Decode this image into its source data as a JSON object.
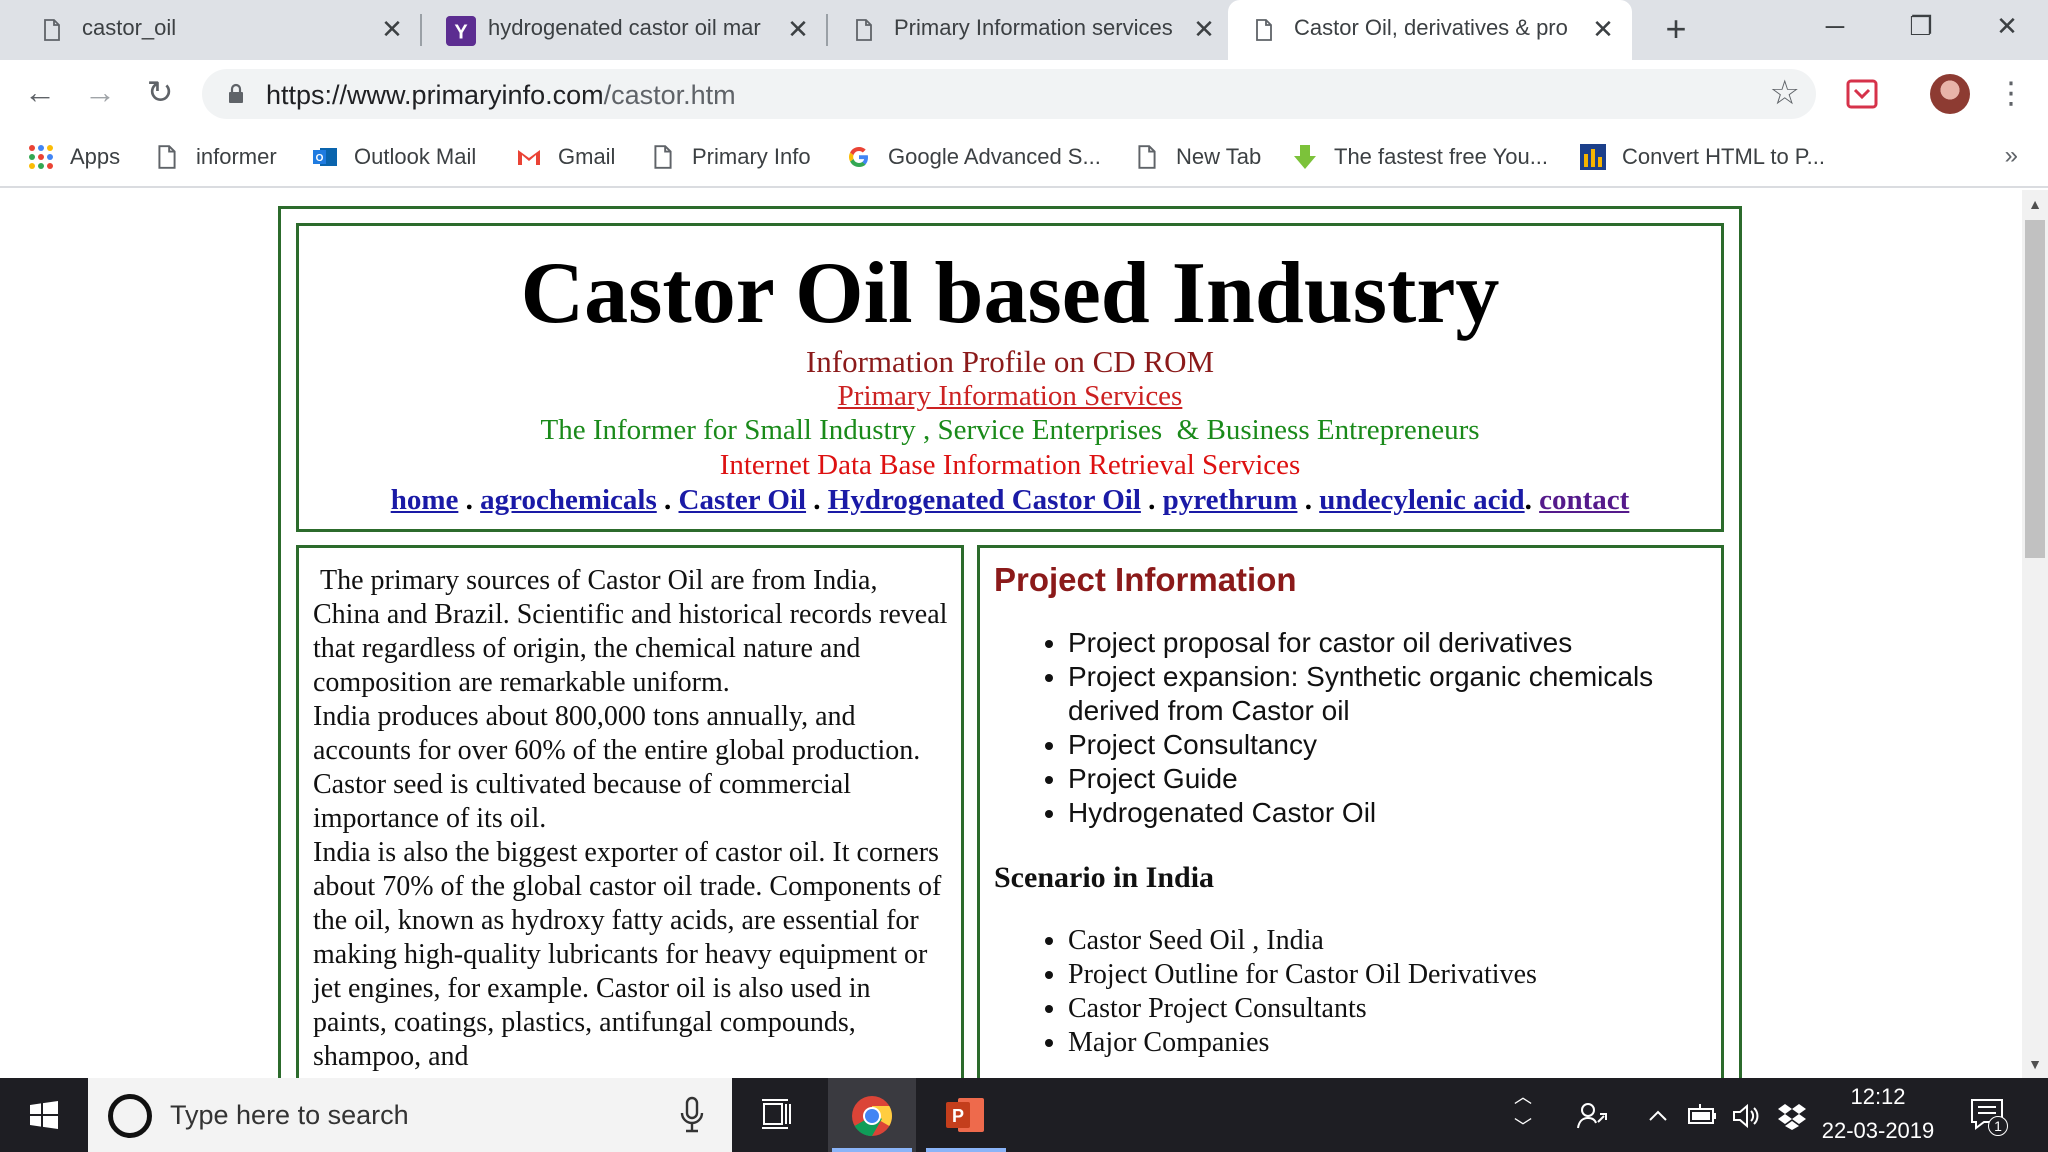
{
  "browser": {
    "tabs": [
      {
        "title": "castor_oil",
        "icon": "page-icon",
        "active": false
      },
      {
        "title": "hydrogenated castor oil mar",
        "icon": "yahoo-icon",
        "active": false
      },
      {
        "title": "Primary Information services",
        "icon": "page-icon",
        "active": false
      },
      {
        "title": "Castor Oil, derivatives & pro",
        "icon": "page-icon",
        "active": true
      }
    ],
    "new_tab_symbol": "+",
    "window_controls": {
      "minimize": "─",
      "restore": "❐",
      "close": "✕"
    },
    "url_host": "https://www.primaryinfo.com",
    "url_path": "/castor.htm",
    "nav": {
      "back": "←",
      "forward": "→",
      "reload": "↻",
      "bookmark_star": "☆",
      "menu": "⋮"
    }
  },
  "bookmarks": {
    "items": [
      {
        "label": "Apps",
        "icon": "apps-grid-icon"
      },
      {
        "label": "informer",
        "icon": "page-icon"
      },
      {
        "label": "Outlook Mail",
        "icon": "outlook-icon"
      },
      {
        "label": "Gmail",
        "icon": "gmail-icon"
      },
      {
        "label": "Primary Info",
        "icon": "page-icon"
      },
      {
        "label": "Google Advanced S...",
        "icon": "google-icon"
      },
      {
        "label": "New Tab",
        "icon": "page-icon"
      },
      {
        "label": "The fastest free You...",
        "icon": "download-arrow-icon"
      },
      {
        "label": "Convert HTML to P...",
        "icon": "bar-chart-icon"
      }
    ],
    "more": "»"
  },
  "page": {
    "header": {
      "title": "Castor Oil based Industry",
      "subtitle": "Information Profile on CD ROM",
      "company_link": "Primary Information Services",
      "tagline": "The Informer for Small Industry , Service Enterprises  & Business Entrepreneurs",
      "service_line": "Internet Data Base Information Retrieval Services"
    },
    "nav_links": [
      {
        "label": "home",
        "visited": false
      },
      {
        "label": "agrochemicals",
        "visited": false
      },
      {
        "label": "Caster Oil",
        "visited": false
      },
      {
        "label": "Hydrogenated Castor Oil",
        "visited": false
      },
      {
        "label": "pyrethrum",
        "visited": false
      },
      {
        "label": "undecylenic acid",
        "visited": false
      },
      {
        "label": "contact",
        "visited": true
      }
    ],
    "nav_separators": [
      " . ",
      " . ",
      " . ",
      " . ",
      " . ",
      ". "
    ],
    "left_paragraphs": [
      " The primary sources of Castor Oil are from India, China and Brazil. Scientific and historical records reveal that regardless of origin, the chemical nature and composition are remarkable uniform.",
      "India produces about 800,000 tons annually, and accounts for over 60% of the entire global production. Castor seed is cultivated because of commercial importance of its oil.",
      "India is also the biggest exporter of castor oil. It corners about 70% of the global castor oil trade. Components of the oil, known as hydroxy fatty acids, are essential for making high-quality lubricants for heavy equipment or jet engines, for example. Castor oil is also used in paints, coatings, plastics, antifungal compounds, shampoo, and"
    ],
    "project_title": "Project Information",
    "project_items": [
      "Project proposal for castor oil derivatives",
      "Project expansion: Synthetic organic chemicals derived from Castor oil",
      "Project Consultancy",
      "Project Guide",
      "Hydrogenated Castor Oil"
    ],
    "scenario_title": "Scenario in India",
    "scenario_items": [
      "Castor Seed Oil , India",
      "Project Outline for Castor Oil Derivatives",
      "Castor Project Consultants",
      "Major Companies"
    ]
  },
  "taskbar": {
    "search_placeholder": "Type here to search",
    "time": "12:12",
    "date": "22-03-2019",
    "notification_count": "1",
    "apps": [
      "task-view-icon",
      "chrome-icon",
      "powerpoint-icon"
    ]
  },
  "colors": {
    "frame_green": "#2c6b2c",
    "title_maroon": "#8b1a1a",
    "link_blue": "#1a1aa6",
    "tagline_green": "#1a8a1a",
    "service_red": "#dd1111"
  }
}
